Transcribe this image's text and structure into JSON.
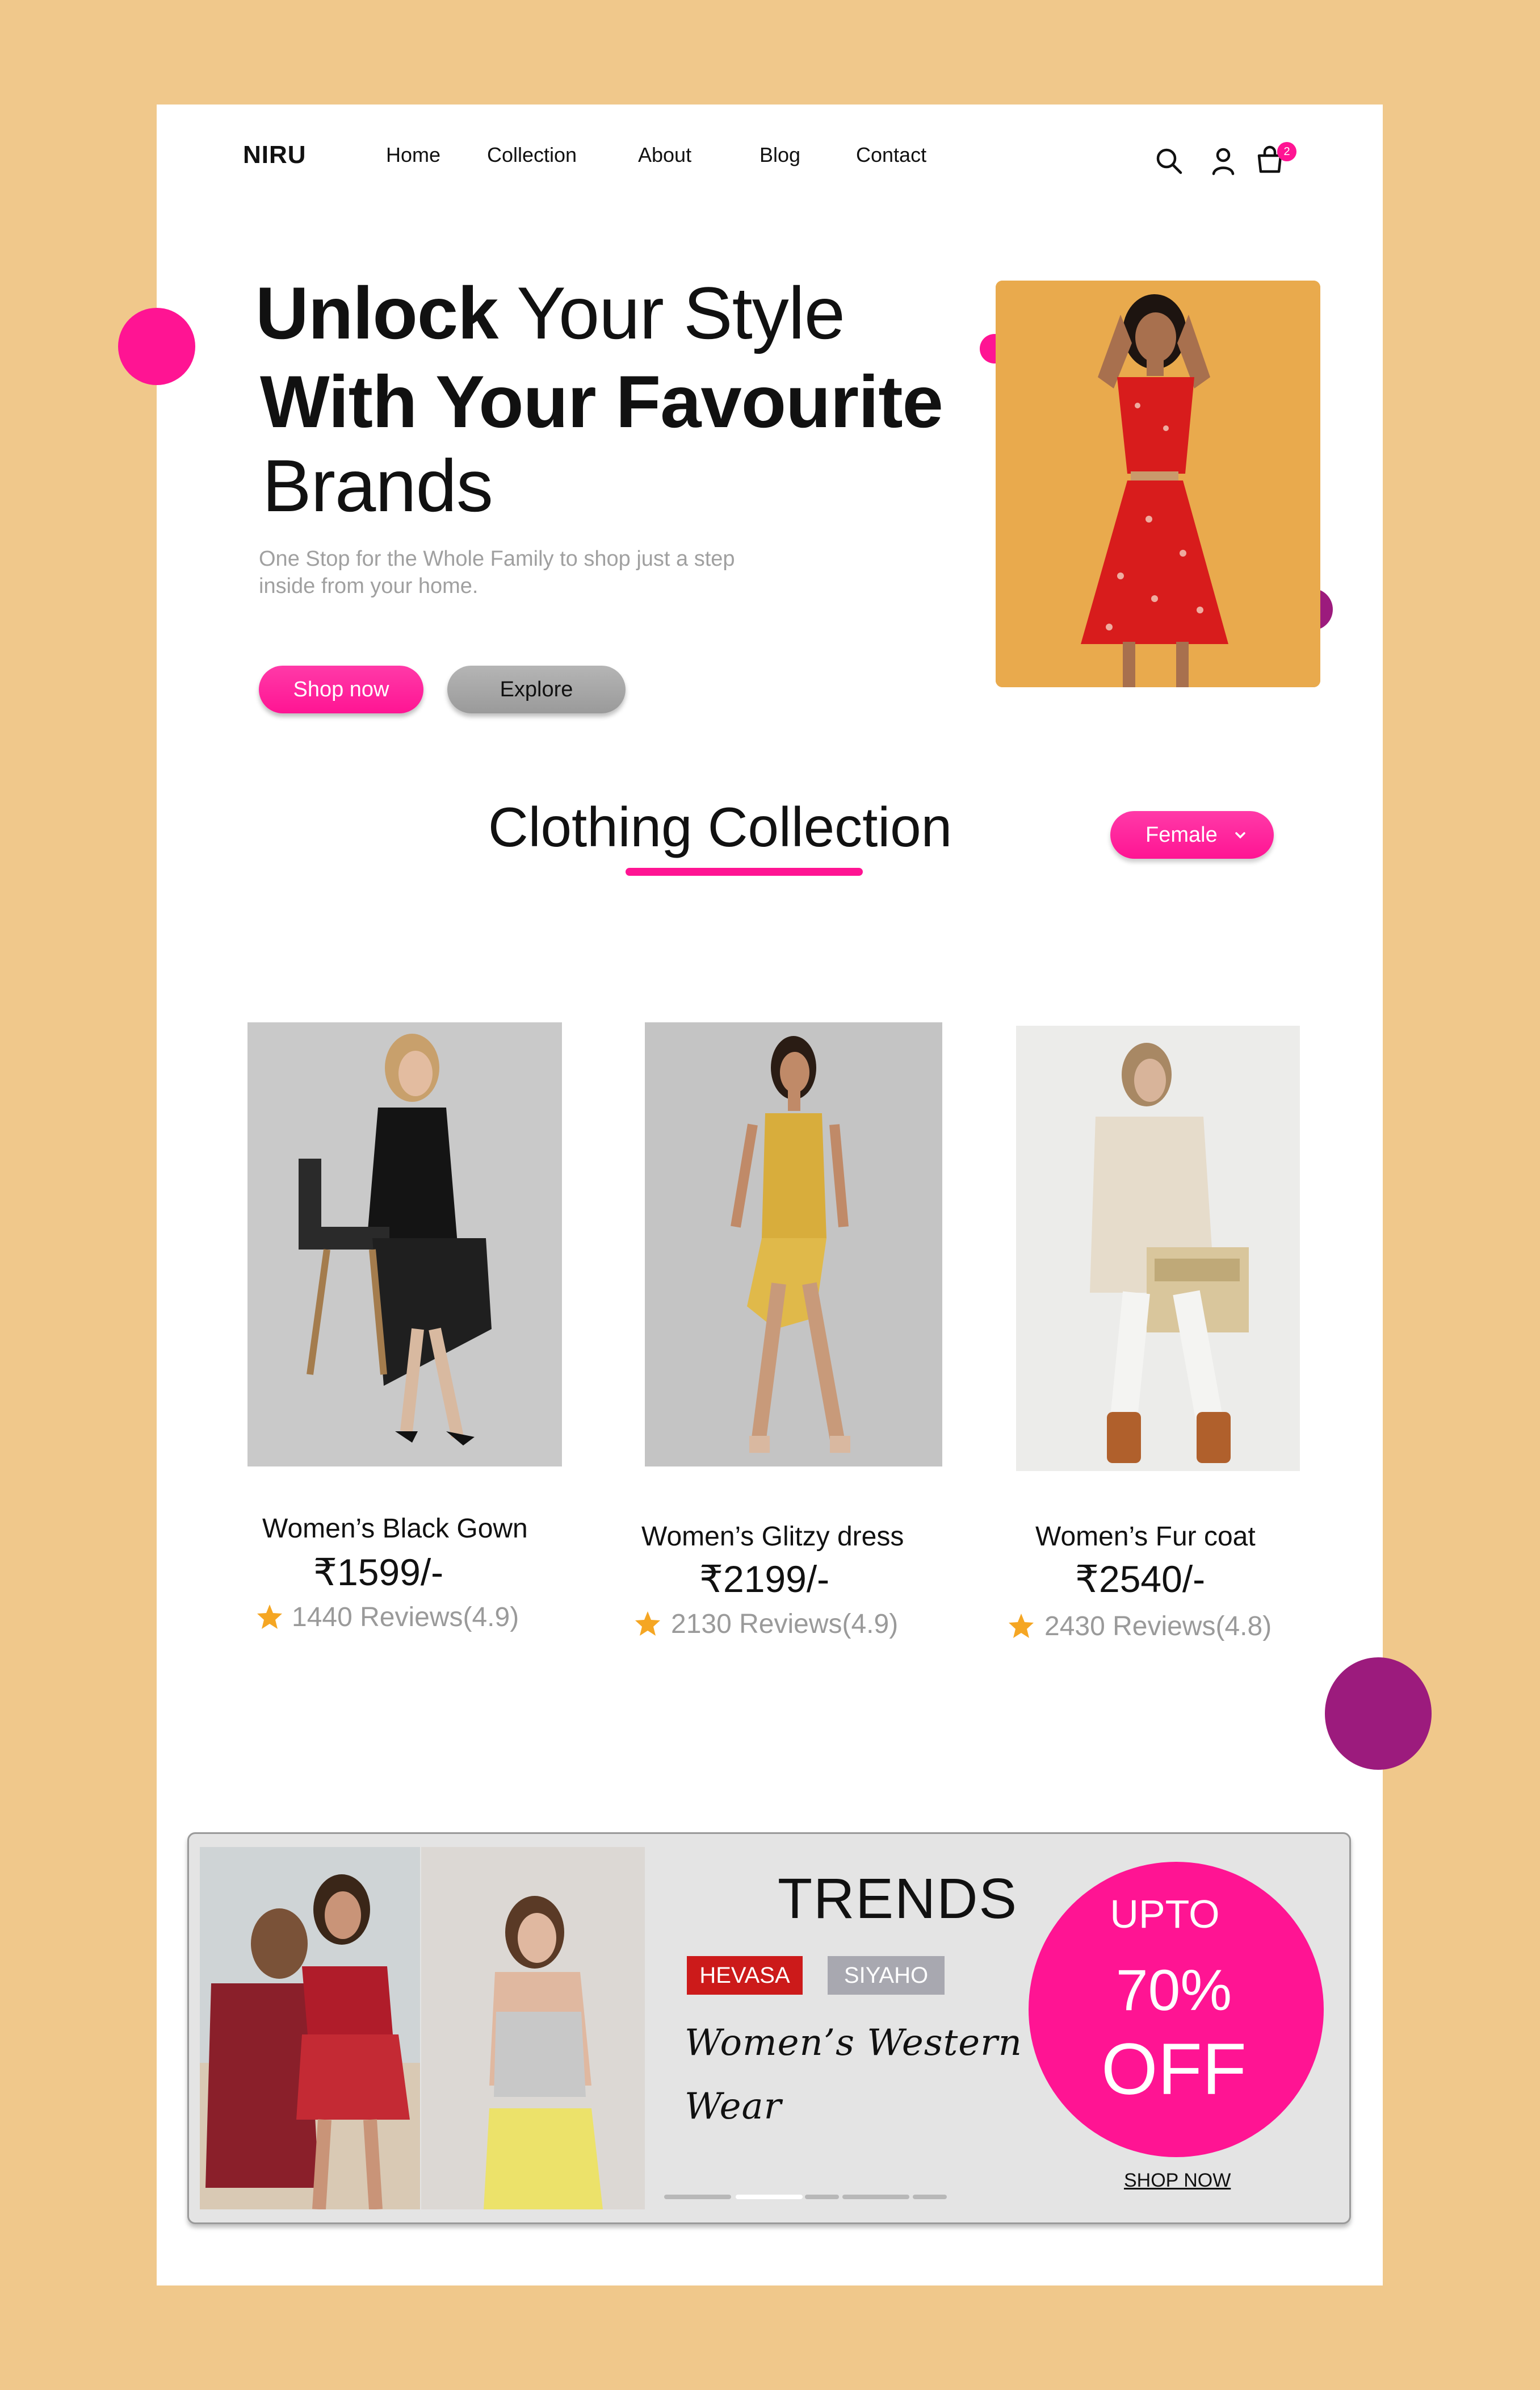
{
  "brand": {
    "logo": "NIRU"
  },
  "nav": {
    "items": [
      {
        "label": "Home"
      },
      {
        "label": "Collection"
      },
      {
        "label": "About"
      },
      {
        "label": "Blog"
      },
      {
        "label": "Contact"
      }
    ],
    "cart_count": "2"
  },
  "hero": {
    "line1_bold": "Unlock",
    "line1_rest": " Your Style",
    "line2_bold": "With Your Favourite",
    "line3": "Brands",
    "subtitle": "One Stop for the Whole Family to shop just a step inside from your home.",
    "shop_button": "Shop now",
    "explore_button": "Explore"
  },
  "collection": {
    "title": "Clothing Collection",
    "filter": {
      "selected": "Female"
    },
    "products": [
      {
        "name": "Women’s Black Gown",
        "price": "₹1599/-",
        "reviews": "1440 Reviews(4.9)"
      },
      {
        "name": "Women’s Glitzy dress",
        "price": "₹2199/-",
        "reviews": "2130 Reviews(4.9)"
      },
      {
        "name": "Women’s Fur coat",
        "price": "₹2540/-",
        "reviews": "2430 Reviews(4.8)"
      }
    ]
  },
  "banner": {
    "title": "TRENDS",
    "tags": [
      "HEVASA",
      "SIYAHO"
    ],
    "script_line1": "Women’s Western",
    "script_line2": "Wear",
    "offer_line1": "UPTO",
    "offer_line2": "70%",
    "offer_line3": "OFF",
    "shop_now": "SHOP NOW"
  },
  "colors": {
    "background": "#f0c88b",
    "accent_pink": "#ff1493",
    "accent_purple": "#9c1b7d",
    "hero_image_bg": "#e9aa4d",
    "tag_red": "#cc1a1a",
    "tag_gray": "#a8a8b0",
    "star": "#f5a623"
  }
}
